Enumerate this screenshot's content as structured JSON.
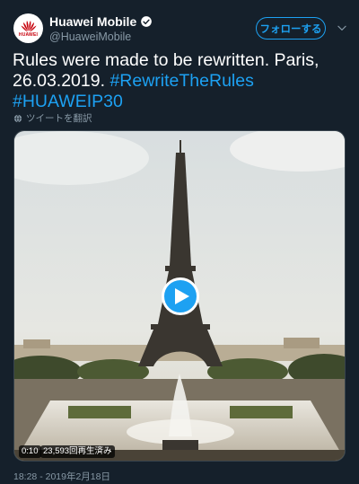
{
  "header": {
    "avatar_logo": "HUAWEI",
    "display_name": "Huawei Mobile",
    "handle": "@HuaweiMobile",
    "follow_label": "フォローする"
  },
  "tweet": {
    "text": "Rules were made to be rewritten. Paris, 26.03.2019.",
    "hashtag_1": "#RewriteTheRules",
    "hashtag_2": "#HUAWEIP30",
    "translate_label": "ツイートを翻訳"
  },
  "media": {
    "type": "video",
    "duration": "0:10",
    "views": "23,593回再生済み"
  },
  "timestamp": "18:28 - 2019年2月18日",
  "colors": {
    "background": "#15202b",
    "accent": "#1da1f2",
    "secondary_text": "#8899a6",
    "brand_red": "#c7000b"
  },
  "icons": [
    "huawei-logo-icon",
    "verified-badge-icon",
    "chevron-down-icon",
    "globe-icon",
    "play-icon"
  ]
}
